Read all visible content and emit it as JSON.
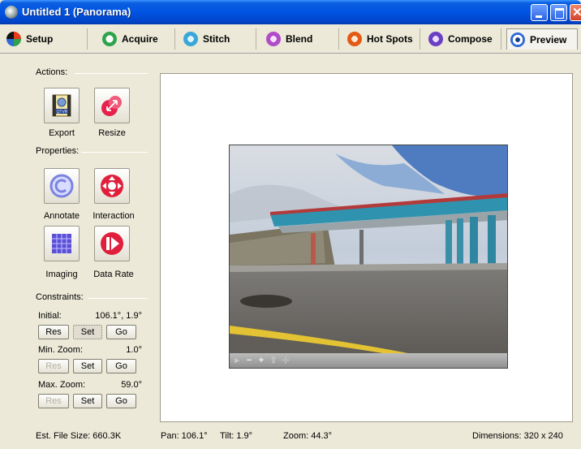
{
  "window": {
    "title": "Untitled 1 (Panorama)"
  },
  "tabs": [
    {
      "label": "Setup",
      "icon": "pie-icon",
      "color": "#e53b1b"
    },
    {
      "label": "Acquire",
      "icon": "circle-arrow-icon",
      "color": "#2ea34c"
    },
    {
      "label": "Stitch",
      "icon": "stitch-icon",
      "color": "#3aa7d8"
    },
    {
      "label": "Blend",
      "icon": "blend-arrow-icon",
      "color": "#b04cc8"
    },
    {
      "label": "Hot Spots",
      "icon": "hotspot-arrow-icon",
      "color": "#e35a14"
    },
    {
      "label": "Compose",
      "icon": "compose-arch-icon",
      "color": "#6a3fc4"
    },
    {
      "label": "Preview",
      "icon": "eye-icon",
      "color": "#2f6bd6"
    }
  ],
  "sidebar": {
    "actions_label": "Actions:",
    "export_label": "Export",
    "resize_label": "Resize",
    "properties_label": "Properties:",
    "annotate_label": "Annotate",
    "interaction_label": "Interaction",
    "imaging_label": "Imaging",
    "datarate_label": "Data Rate",
    "constraints_label": "Constraints:",
    "initial": {
      "label": "Initial:",
      "value": "106.1°,  1.9°"
    },
    "min_zoom": {
      "label": "Min. Zoom:",
      "value": "1.0°"
    },
    "max_zoom": {
      "label": "Max. Zoom:",
      "value": "59.0°"
    },
    "res_label": "Res",
    "set_label": "Set",
    "go_label": "Go"
  },
  "preview": {
    "controls": [
      "▸",
      "−",
      "+",
      "⇧",
      "⊹"
    ]
  },
  "status": {
    "file_size": "Est. File Size:  660.3K",
    "pan": "Pan: 106.1°",
    "tilt": "Tilt: 1.9°",
    "zoom": "Zoom: 44.3°",
    "dimensions": "Dimensions: 320 x 240"
  }
}
